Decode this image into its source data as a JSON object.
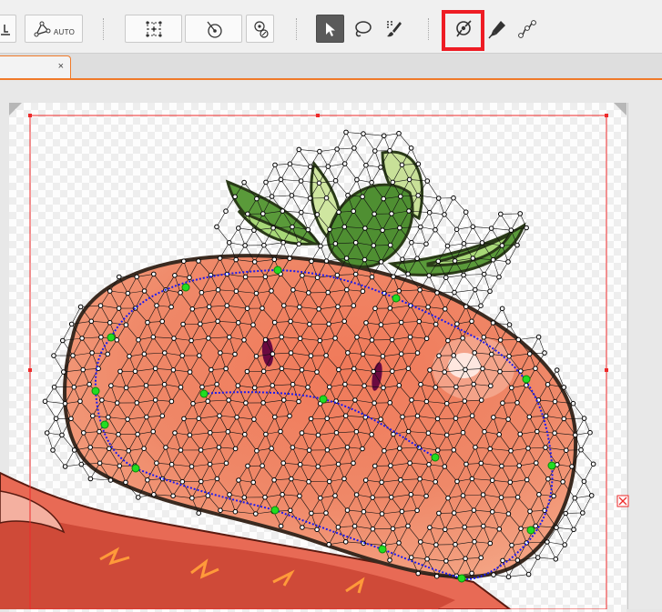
{
  "toolbar": {
    "auto_label": "AUTO",
    "highlighted_tool": "mesh-pin-tool",
    "tools": [
      {
        "name": "partial-tool-icon"
      },
      {
        "name": "auto-mesh-icon"
      },
      {
        "name": "grid-mesh-icon"
      },
      {
        "name": "deform-point-icon"
      },
      {
        "name": "deform-pin-icon"
      },
      {
        "name": "select-arrow-icon"
      },
      {
        "name": "lasso-icon"
      },
      {
        "name": "brush-icon"
      },
      {
        "name": "mesh-pin-tool-icon"
      },
      {
        "name": "pen-icon"
      },
      {
        "name": "path-edit-icon"
      }
    ]
  },
  "tabs": [
    {
      "label": "",
      "close": "×",
      "active": true
    }
  ],
  "colors": {
    "accent": "#f07a2a",
    "highlight": "#ee1c24",
    "bounding_box": "#ee2a2a",
    "stroke_guide": "#1a1aee",
    "pin_point": "#22dd22",
    "mesh_line": "#111111"
  },
  "canvas": {
    "artwork": "tomato-character",
    "status_marker_icon": "close-x-icon"
  }
}
